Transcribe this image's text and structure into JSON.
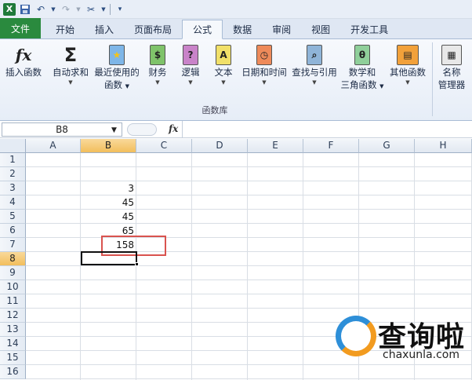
{
  "qat": {
    "logo": "X"
  },
  "tabs": [
    "文件",
    "开始",
    "插入",
    "页面布局",
    "公式",
    "数据",
    "审阅",
    "视图",
    "开发工具"
  ],
  "ribbon": {
    "buttons": [
      {
        "label": "插入函数",
        "label2": "",
        "icon": "fx",
        "dropdown": false
      },
      {
        "label": "自动求和",
        "label2": "",
        "icon": "Σ",
        "dropdown": true
      },
      {
        "label": "最近使用的",
        "label2": "函数",
        "icon": "★",
        "dropdown": true
      },
      {
        "label": "财务",
        "label2": "",
        "icon": "$",
        "dropdown": true
      },
      {
        "label": "逻辑",
        "label2": "",
        "icon": "?",
        "dropdown": true
      },
      {
        "label": "文本",
        "label2": "",
        "icon": "A",
        "dropdown": true
      },
      {
        "label": "日期和时间",
        "label2": "",
        "icon": "◷",
        "dropdown": true
      },
      {
        "label": "查找与引用",
        "label2": "",
        "icon": "⌕",
        "dropdown": true
      },
      {
        "label": "数学和",
        "label2": "三角函数",
        "icon": "θ",
        "dropdown": true
      },
      {
        "label": "其他函数",
        "label2": "",
        "icon": "▤",
        "dropdown": true
      },
      {
        "label": "名称",
        "label2": "管理器",
        "icon": "▦",
        "dropdown": false
      }
    ],
    "group_label": "函数库"
  },
  "formula_bar": {
    "name_box": "B8",
    "fx": "fx",
    "value": ""
  },
  "columns": [
    "A",
    "B",
    "C",
    "D",
    "E",
    "F",
    "G",
    "H"
  ],
  "rows": [
    "1",
    "2",
    "3",
    "4",
    "5",
    "6",
    "7",
    "8",
    "9",
    "10",
    "11",
    "12",
    "13",
    "14",
    "15",
    "16"
  ],
  "cells": {
    "B3": "3",
    "B4": "45",
    "B5": "45",
    "B6": "65",
    "B7": "158"
  },
  "selected": {
    "column": "B",
    "row": "8"
  },
  "watermark": {
    "text": "查询啦",
    "url": "chaxunla.com"
  },
  "colors": {
    "file_tab": "#2a8a3e",
    "highlight_box": "#d9534f",
    "selection_header": "#f2be5c"
  }
}
